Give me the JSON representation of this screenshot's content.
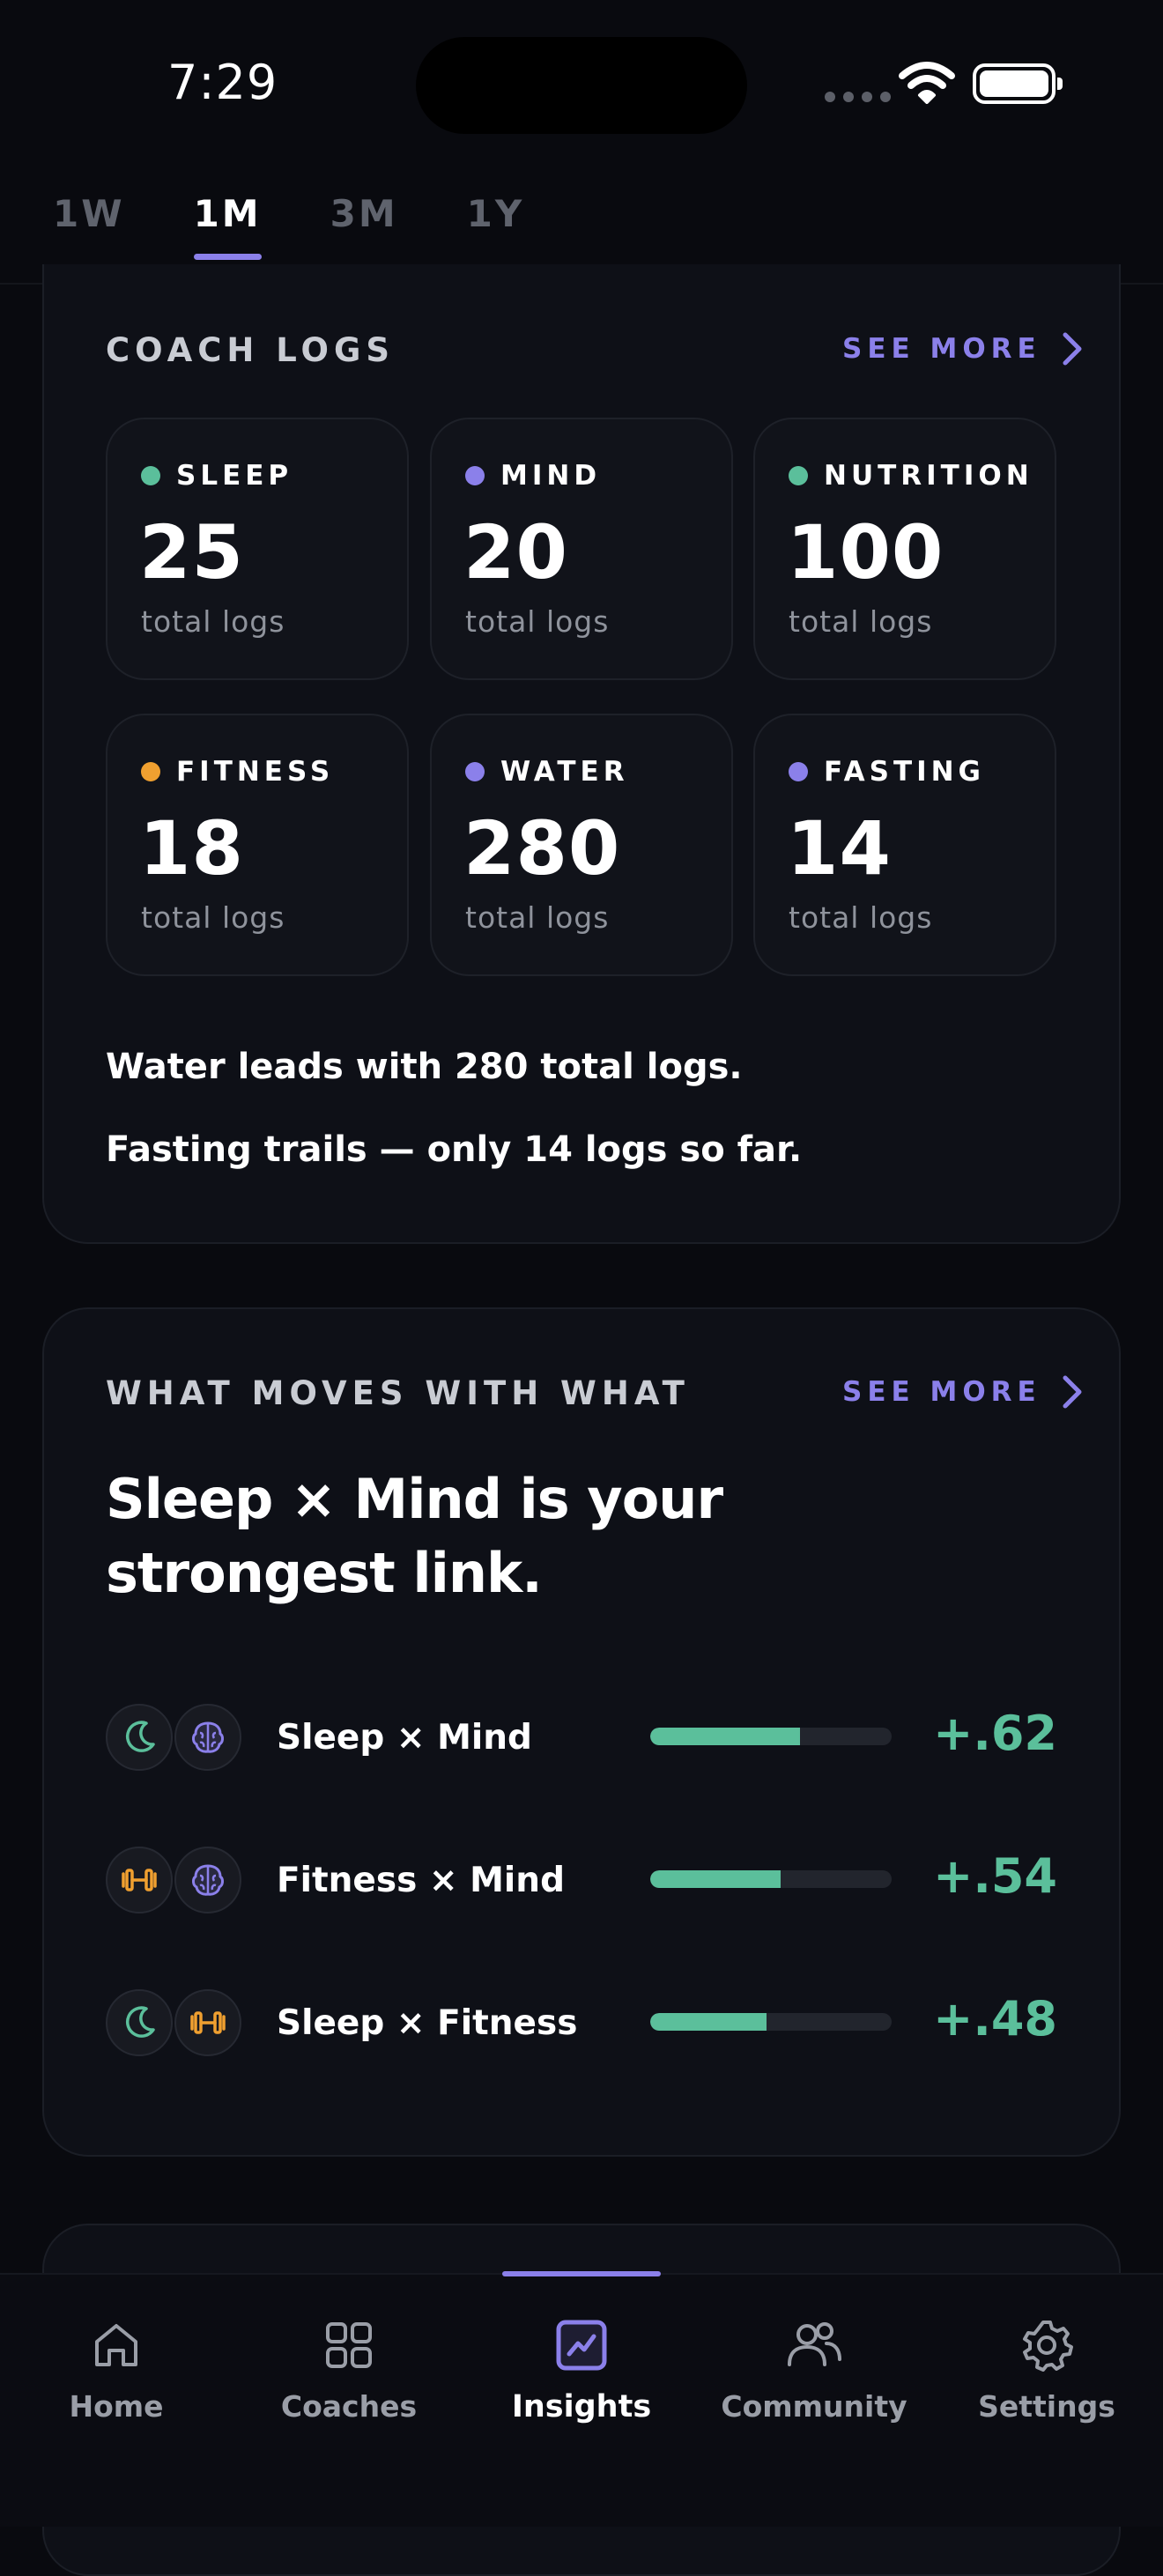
{
  "status_bar": {
    "time": "7:29"
  },
  "tabs": [
    {
      "label": "1W",
      "active": false
    },
    {
      "label": "1M",
      "active": true
    },
    {
      "label": "3M",
      "active": false
    },
    {
      "label": "1Y",
      "active": false
    }
  ],
  "coach_logs": {
    "title": "COACH LOGS",
    "see_more": "SEE MORE",
    "tiles": [
      {
        "label": "SLEEP",
        "value": "25",
        "sub": "total logs",
        "color": "#5bbf9b"
      },
      {
        "label": "MIND",
        "value": "20",
        "sub": "total logs",
        "color": "#8b80ea"
      },
      {
        "label": "NUTRITION",
        "value": "100",
        "sub": "total logs",
        "color": "#5bbf9b"
      },
      {
        "label": "FITNESS",
        "value": "18",
        "sub": "total logs",
        "color": "#f0a030"
      },
      {
        "label": "WATER",
        "value": "280",
        "sub": "total logs",
        "color": "#8b80ea"
      },
      {
        "label": "FASTING",
        "value": "14",
        "sub": "total logs",
        "color": "#8b80ea"
      }
    ],
    "summary_1": "Water leads with 280 total logs.",
    "summary_2": "Fasting trails — only 14 logs so far."
  },
  "correlations": {
    "title": "WHAT MOVES WITH WHAT",
    "see_more": "SEE MORE",
    "headline_1": "Sleep × Mind is your",
    "headline_2": "strongest link.",
    "rows": [
      {
        "label": "Sleep × Mind",
        "value": "+.62",
        "strength": 0.62,
        "icons": [
          "moon-icon",
          "brain-icon"
        ]
      },
      {
        "label": "Fitness × Mind",
        "value": "+.54",
        "strength": 0.54,
        "icons": [
          "dumbbell-icon",
          "brain-icon"
        ]
      },
      {
        "label": "Sleep × Fitness",
        "value": "+.48",
        "strength": 0.48,
        "icons": [
          "moon-icon",
          "dumbbell-icon"
        ]
      }
    ]
  },
  "bottom_nav": [
    {
      "label": "Home",
      "icon": "home-icon",
      "active": false
    },
    {
      "label": "Coaches",
      "icon": "grid-icon",
      "active": false
    },
    {
      "label": "Insights",
      "icon": "chart-icon",
      "active": true
    },
    {
      "label": "Community",
      "icon": "people-icon",
      "active": false
    },
    {
      "label": "Settings",
      "icon": "gear-icon",
      "active": false
    }
  ],
  "colors": {
    "accent": "#8b80ea",
    "positive": "#5bbf9b",
    "fitness": "#f0a030",
    "background": "#090a0f"
  }
}
